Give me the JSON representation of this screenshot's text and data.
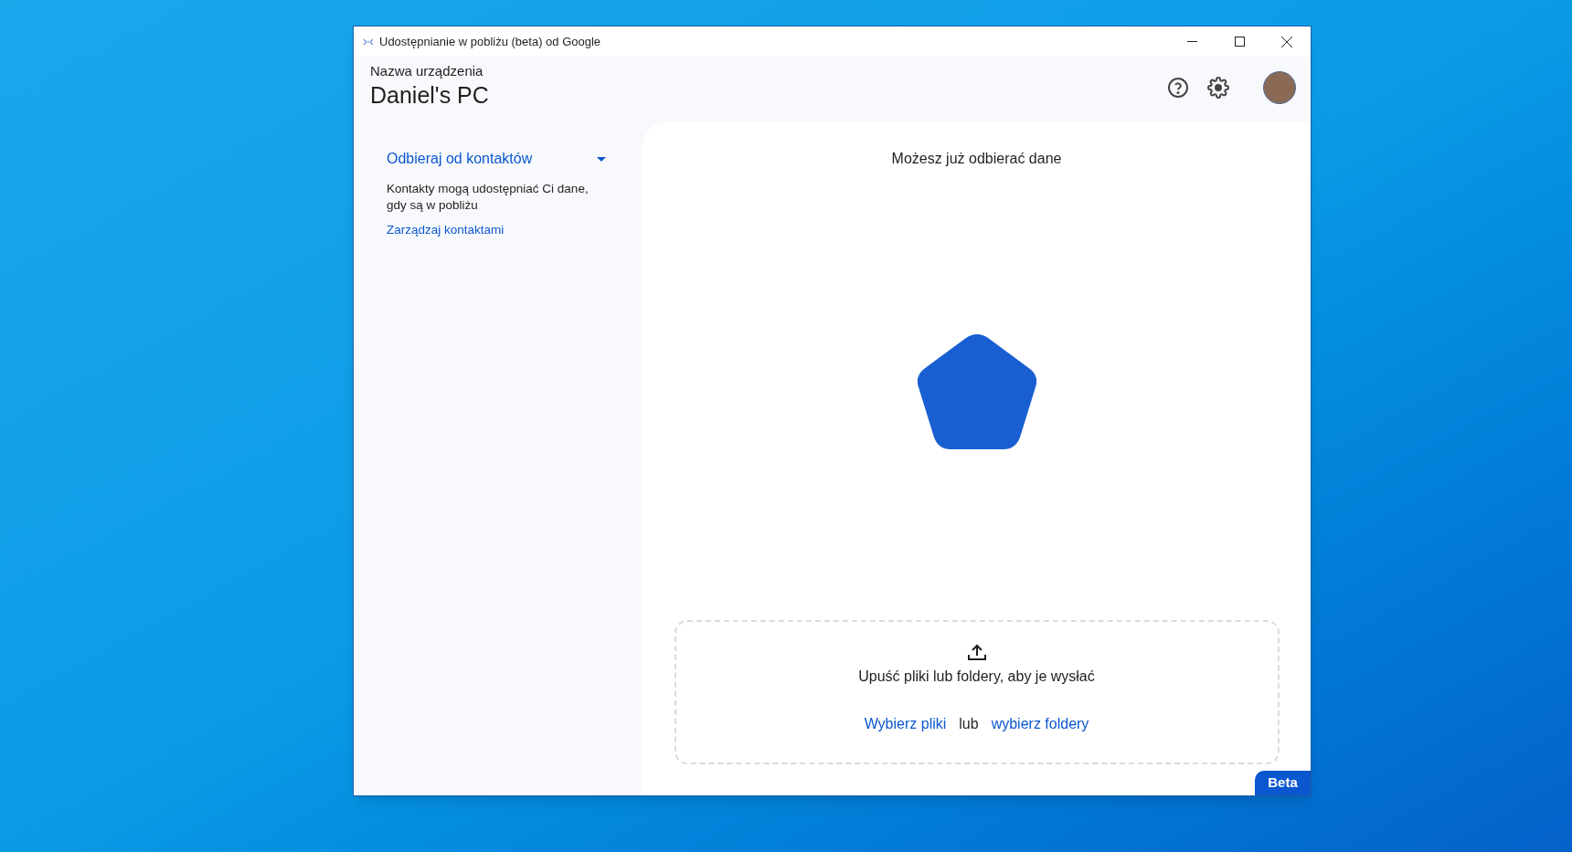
{
  "window": {
    "title": "Udostępnianie w pobliżu (beta) od Google"
  },
  "header": {
    "label": "Nazwa urządzenia",
    "device_name": "Daniel's PC"
  },
  "sidebar": {
    "visibility": "Odbieraj od kontaktów",
    "description": "Kontakty mogą udostępniać Ci dane, gdy są w pobliżu",
    "link": "Zarządzaj kontaktami"
  },
  "main": {
    "status": "Możesz już odbierać dane"
  },
  "dropzone": {
    "text": "Upuść pliki lub foldery, aby je wysłać",
    "choose_files": "Wybierz pliki",
    "separator": "lub",
    "choose_folders": "wybierz foldery"
  },
  "badge": "Beta"
}
